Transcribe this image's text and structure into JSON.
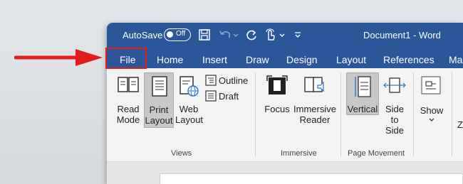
{
  "window": {
    "autosave_label": "AutoSave",
    "autosave_state": "Off",
    "document_title": "Document1 - Word"
  },
  "tabs": [
    {
      "label": "File"
    },
    {
      "label": "Home"
    },
    {
      "label": "Insert"
    },
    {
      "label": "Draw"
    },
    {
      "label": "Design"
    },
    {
      "label": "Layout"
    },
    {
      "label": "References"
    },
    {
      "label": "Ma"
    }
  ],
  "ribbon": {
    "views": {
      "group_label": "Views",
      "read_mode": {
        "line1": "Read",
        "line2": "Mode"
      },
      "print_layout": {
        "line1": "Print",
        "line2": "Layout"
      },
      "web_layout": {
        "line1": "Web",
        "line2": "Layout"
      },
      "outline": "Outline",
      "draft": "Draft"
    },
    "immersive": {
      "group_label": "Immersive",
      "focus": "Focus",
      "immersive_reader": {
        "line1": "Immersive",
        "line2": "Reader"
      }
    },
    "page_movement": {
      "group_label": "Page Movement",
      "vertical": "Vertical",
      "side_to_side": {
        "line1": "Side",
        "line2": "to Side"
      }
    },
    "show": {
      "label": "Show"
    },
    "zoom_partial": "Z"
  },
  "colors": {
    "titlebar": "#2b579a",
    "ribbon_bg": "#f3f3f3",
    "annotation": "#e21b1b",
    "selected_button": "#c8c8c8"
  }
}
